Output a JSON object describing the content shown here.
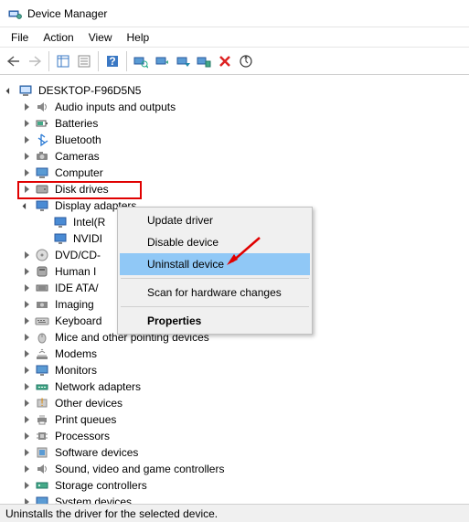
{
  "window": {
    "title": "Device Manager"
  },
  "menu": {
    "file": "File",
    "action": "Action",
    "view": "View",
    "help": "Help"
  },
  "tree": {
    "root": "DESKTOP-F96D5N5",
    "items": [
      {
        "label": "Audio inputs and outputs"
      },
      {
        "label": "Batteries"
      },
      {
        "label": "Bluetooth"
      },
      {
        "label": "Cameras"
      },
      {
        "label": "Computer"
      },
      {
        "label": "Disk drives"
      },
      {
        "label": "Display adapters",
        "expanded": true,
        "children": [
          {
            "label": "Intel(R"
          },
          {
            "label": "NVIDI"
          }
        ]
      },
      {
        "label": "DVD/CD-"
      },
      {
        "label": "Human I"
      },
      {
        "label": "IDE ATA/"
      },
      {
        "label": "Imaging "
      },
      {
        "label": "Keyboard"
      },
      {
        "label": "Mice and other pointing devices"
      },
      {
        "label": "Modems"
      },
      {
        "label": "Monitors"
      },
      {
        "label": "Network adapters"
      },
      {
        "label": "Other devices"
      },
      {
        "label": "Print queues"
      },
      {
        "label": "Processors"
      },
      {
        "label": "Software devices"
      },
      {
        "label": "Sound, video and game controllers"
      },
      {
        "label": "Storage controllers"
      },
      {
        "label": "System devices"
      }
    ]
  },
  "context_menu": {
    "update": "Update driver",
    "disable": "Disable device",
    "uninstall": "Uninstall device",
    "scan": "Scan for hardware changes",
    "properties": "Properties"
  },
  "status": "Uninstalls the driver for the selected device.",
  "icons": {
    "computer": "computer-icon",
    "speaker": "speaker-icon",
    "battery": "battery-icon",
    "bluetooth": "bluetooth-icon",
    "camera": "camera-icon",
    "pc": "pc-icon",
    "disk": "disk-icon",
    "display": "display-icon",
    "dvd": "dvd-icon",
    "hid": "hid-icon",
    "ide": "ide-icon",
    "imaging": "imaging-icon",
    "keyboard": "keyboard-icon",
    "mouse": "mouse-icon",
    "modem": "modem-icon",
    "monitor": "monitor-icon",
    "network": "network-icon",
    "other": "other-icon",
    "printer": "printer-icon",
    "cpu": "cpu-icon",
    "software": "software-icon",
    "sound": "sound-icon",
    "storage": "storage-icon",
    "system": "system-icon"
  }
}
